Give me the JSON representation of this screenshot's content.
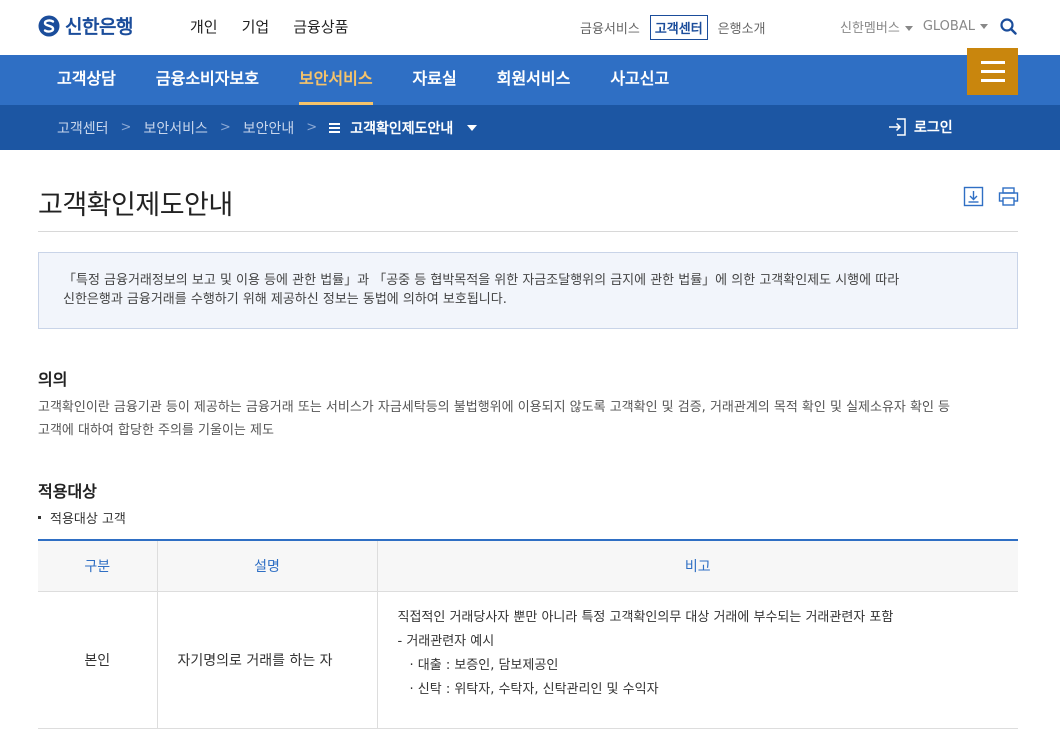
{
  "header": {
    "logo_text": "신한은행",
    "gnb": [
      "개인",
      "기업",
      "금융상품"
    ],
    "util": [
      "금융서비스",
      "고객센터",
      "은행소개"
    ],
    "util_active_index": 1,
    "members": "신한멤버스",
    "global": "GLOBAL"
  },
  "mainnav": {
    "items": [
      "고객상담",
      "금융소비자보호",
      "보안서비스",
      "자료실",
      "회원서비스",
      "사고신고"
    ],
    "active_index": 2
  },
  "breadcrumb": {
    "items": [
      "고객센터",
      "보안서비스",
      "보안안내"
    ],
    "current": "고객확인제도안내",
    "login": "로그인"
  },
  "page": {
    "title": "고객확인제도안내",
    "notice_line1": "「특정 금융거래정보의 보고 및 이용 등에 관한 법률」과 「공중 등 협박목적을 위한 자금조달행위의 금지에 관한 법률」에 의한 고객확인제도 시행에 따라",
    "notice_line2": "신한은행과 금융거래를 수행하기 위해 제공하신 정보는 동법에 의하여 보호됩니다."
  },
  "section1": {
    "title": "의의",
    "line1": "고객확인이란 금융기관 등이 제공하는 금융거래 또는 서비스가 자금세탁등의 불법행위에 이용되지 않도록 고객확인 및 검증, 거래관계의 목적 확인 및 실제소유자 확인 등",
    "line2": "고객에 대하여 합당한 주의를 기울이는 제도"
  },
  "section2": {
    "title": "적용대상",
    "bullet": "적용대상 고객"
  },
  "table": {
    "headers": [
      "구분",
      "설명",
      "비고"
    ],
    "rows": [
      {
        "name": "본인",
        "desc": "자기명의로 거래를 하는 자",
        "note1": "직접적인 거래당사자 뿐만 아니라 특정 고객확인의무 대상 거래에 부수되는 거래관련자 포함",
        "note2": "-  거래관련자 예시",
        "note3": "·  대출 : 보증인, 담보제공인",
        "note4": "·  신탁 : 위탁자, 수탁자, 신탁관리인 및 수익자"
      }
    ]
  },
  "colors": {
    "brand_blue": "#2f6fc4",
    "dark_blue": "#1c56a3",
    "accent_gold": "#c9860d",
    "active_nav": "#f5c36b"
  }
}
